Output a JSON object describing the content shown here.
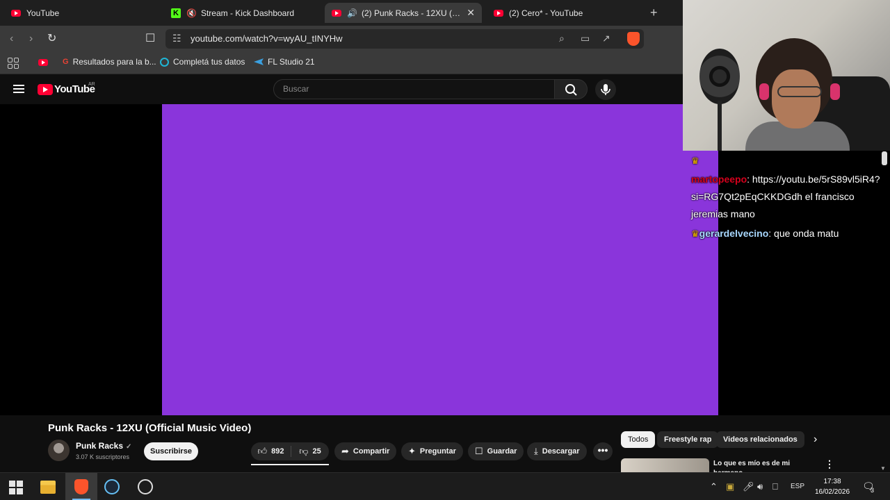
{
  "browser": {
    "tabs": [
      {
        "title": "YouTube",
        "favicon": "youtube-icon",
        "active": false
      },
      {
        "title": "Stream - Kick Dashboard",
        "favicon": "kick-icon",
        "muted": true,
        "active": false
      },
      {
        "title": "(2) Punk Racks - 12XU (Official Music Video)",
        "favicon": "youtube-icon",
        "audio": true,
        "active": true
      },
      {
        "title": "(2) Cero* - YouTube",
        "favicon": "youtube-icon",
        "active": false
      }
    ],
    "url": "youtube.com/watch?v=wyAU_tINYHw",
    "shield_badge": "18",
    "bookmarks": [
      {
        "label": "",
        "icon": "youtube-icon"
      },
      {
        "label": "Resultados para la b...",
        "icon": "google-icon"
      },
      {
        "label": "Completá tus datos",
        "icon": "circle-icon"
      },
      {
        "label": "FL Studio 21",
        "icon": "fl-studio-icon"
      }
    ]
  },
  "youtube": {
    "logo_text": "YouTube",
    "region": "AR",
    "search_placeholder": "Buscar",
    "video": {
      "title": "Punk Racks - 12XU (Official Music Video)",
      "channel": "Punk Racks",
      "subscribers": "3.07 K suscriptores",
      "subscribe_label": "Suscribirse",
      "likes": "892",
      "dislikes": "25",
      "share_label": "Compartir",
      "ask_label": "Preguntar",
      "save_label": "Guardar",
      "download_label": "Descargar",
      "more_label": "•••",
      "player_color": "#8a35db"
    },
    "chips": [
      "Todos",
      "Freestyle rap",
      "Videos relacionados"
    ],
    "recommendation": {
      "title": "Lo que es mío es de mi hermano"
    }
  },
  "chat": {
    "messages": [
      {
        "user": "",
        "badge": "crown",
        "text": ""
      },
      {
        "user": "martopeepo",
        "badge": "",
        "text": ": https://youtu.be/5rS89vl5iR4?si=RG7Qt2pEqCKKDGdh el francisco jeremias mano",
        "user_color": "#d6001c"
      },
      {
        "user": "gerardelvecino",
        "badge": "crown",
        "text": ": que onda matu",
        "user_color": "#a8d8ff"
      }
    ]
  },
  "taskbar": {
    "language": "ESP",
    "time": "17:38",
    "date": "16/02/2026",
    "notifications": "3"
  }
}
